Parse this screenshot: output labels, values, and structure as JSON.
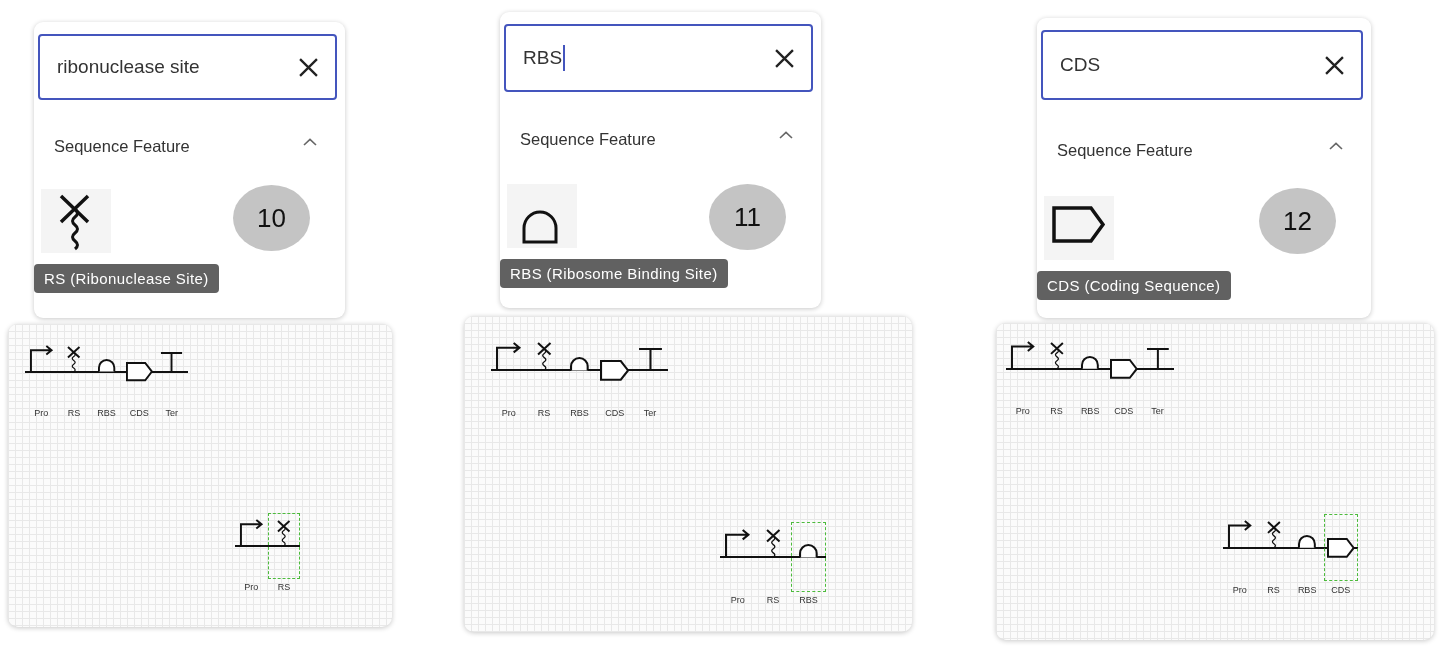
{
  "panels": [
    {
      "search": {
        "value": "ribonuclease site",
        "caret": false
      },
      "category": {
        "label": "Sequence Feature",
        "expanded": true
      },
      "result": {
        "kind": "ribonuclease_site",
        "tooltip": "RS (Ribonuclease Site)"
      },
      "step": "10",
      "template": [
        {
          "kind": "promoter",
          "label": "Pro",
          "selected": false
        },
        {
          "kind": "ribonuclease_site",
          "label": "RS",
          "selected": false
        },
        {
          "kind": "rbs",
          "label": "RBS",
          "selected": false
        },
        {
          "kind": "cds",
          "label": "CDS",
          "selected": false
        },
        {
          "kind": "terminator",
          "label": "Ter",
          "selected": false
        }
      ],
      "construct": [
        {
          "kind": "promoter",
          "label": "Pro",
          "selected": false
        },
        {
          "kind": "ribonuclease_site",
          "label": "RS",
          "selected": true
        }
      ]
    },
    {
      "search": {
        "value": "RBS",
        "caret": true
      },
      "category": {
        "label": "Sequence Feature",
        "expanded": true
      },
      "result": {
        "kind": "rbs",
        "tooltip": "RBS (Ribosome Binding Site)"
      },
      "step": "11",
      "template": [
        {
          "kind": "promoter",
          "label": "Pro",
          "selected": false
        },
        {
          "kind": "ribonuclease_site",
          "label": "RS",
          "selected": false
        },
        {
          "kind": "rbs",
          "label": "RBS",
          "selected": false
        },
        {
          "kind": "cds",
          "label": "CDS",
          "selected": false
        },
        {
          "kind": "terminator",
          "label": "Ter",
          "selected": false
        }
      ],
      "construct": [
        {
          "kind": "promoter",
          "label": "Pro",
          "selected": false
        },
        {
          "kind": "ribonuclease_site",
          "label": "RS",
          "selected": false
        },
        {
          "kind": "rbs",
          "label": "RBS",
          "selected": true
        }
      ]
    },
    {
      "search": {
        "value": "CDS",
        "caret": false
      },
      "category": {
        "label": "Sequence Feature",
        "expanded": true
      },
      "result": {
        "kind": "cds",
        "tooltip": "CDS (Coding Sequence)"
      },
      "step": "12",
      "template": [
        {
          "kind": "promoter",
          "label": "Pro",
          "selected": false
        },
        {
          "kind": "ribonuclease_site",
          "label": "RS",
          "selected": false
        },
        {
          "kind": "rbs",
          "label": "RBS",
          "selected": false
        },
        {
          "kind": "cds",
          "label": "CDS",
          "selected": false
        },
        {
          "kind": "terminator",
          "label": "Ter",
          "selected": false
        }
      ],
      "construct": [
        {
          "kind": "promoter",
          "label": "Pro",
          "selected": false
        },
        {
          "kind": "ribonuclease_site",
          "label": "RS",
          "selected": false
        },
        {
          "kind": "rbs",
          "label": "RBS",
          "selected": false
        },
        {
          "kind": "cds",
          "label": "CDS",
          "selected": true
        }
      ]
    }
  ]
}
